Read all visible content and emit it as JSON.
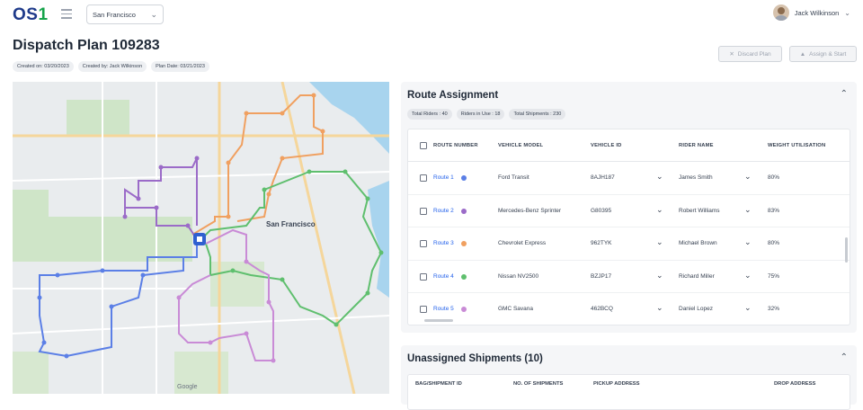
{
  "app": {
    "logo_text": "OS",
    "logo_num": "1"
  },
  "header": {
    "city_select": "San Francisco",
    "user_name": "Jack Wilkinson"
  },
  "page": {
    "title": "Dispatch Plan 109283",
    "chips": [
      "Created on: 03/20/2023",
      "Created by: Jack Wilkinson",
      "Plan Date: 03/21/2023"
    ],
    "discard_label": "Discard Plan",
    "assign_label": "Assign & Start"
  },
  "map": {
    "city_label": "San Francisco",
    "google_label": "Google",
    "route_colors": {
      "route1": "#5b7fe6",
      "route2": "#9b6bc8",
      "route3": "#f0a060",
      "route4": "#5fbf6e",
      "route5": "#c98bd6"
    }
  },
  "route_assignment": {
    "title": "Route Assignment",
    "stats": [
      "Total Riders : 40",
      "Riders in Use : 18",
      "Total Shipments : 230"
    ],
    "columns": [
      "Route Number",
      "Vehicle Model",
      "Vehicle ID",
      "Rider Name",
      "Weight Utilisation"
    ],
    "rows": [
      {
        "route": "Route 1",
        "color": "#5b7fe6",
        "model": "Ford Transit",
        "vid": "8AJH187",
        "rider": "James Smith",
        "weight": "80%"
      },
      {
        "route": "Route 2",
        "color": "#9b6bc8",
        "model": "Mercedes-Benz Sprinter",
        "vid": "G80395",
        "rider": "Robert Williams",
        "weight": "83%"
      },
      {
        "route": "Route 3",
        "color": "#f0a060",
        "model": "Chevrolet Express",
        "vid": "962TYK",
        "rider": "Michael Brown",
        "weight": "80%"
      },
      {
        "route": "Route 4",
        "color": "#5fbf6e",
        "model": "Nissan NV2500",
        "vid": "BZJP17",
        "rider": "Richard Miller",
        "weight": "75%"
      },
      {
        "route": "Route 5",
        "color": "#c98bd6",
        "model": "GMC Savana",
        "vid": "462BCQ",
        "rider": "Daniel Lopez",
        "weight": "32%"
      }
    ]
  },
  "unassigned": {
    "title": "Unassigned Shipments (10)",
    "columns": [
      "Bag/Shipment ID",
      "No. of Shipments",
      "Pickup Address",
      "Drop Address"
    ]
  }
}
